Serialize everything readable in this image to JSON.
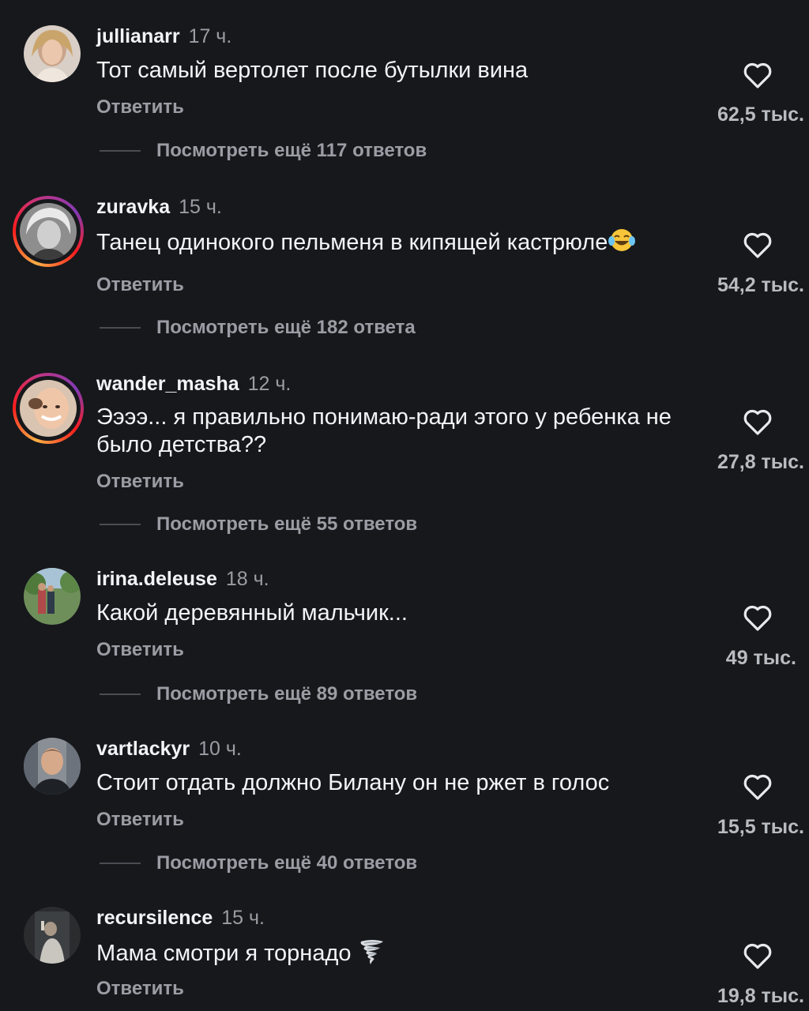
{
  "comments": [
    {
      "username": "jullianarr",
      "time": "17 ч.",
      "text": "Тот самый вертолет после бутылки вина",
      "reply_label": "Ответить",
      "likes": "62,5 тыс.",
      "more_replies": "Посмотреть ещё 117 ответов",
      "avatar_has_story": false
    },
    {
      "username": "zuravka",
      "time": "15 ч.",
      "text": "Танец одинокого пельменя в кипящей кастрюле",
      "emoji": "😂",
      "reply_label": "Ответить",
      "likes": "54,2 тыс.",
      "more_replies": "Посмотреть ещё 182 ответа",
      "avatar_has_story": true
    },
    {
      "username": "wander_masha",
      "time": "12 ч.",
      "text": "Ээээ... я правильно понимаю-ради этого у ребенка не было детства??",
      "reply_label": "Ответить",
      "likes": "27,8 тыс.",
      "more_replies": "Посмотреть ещё 55 ответов",
      "avatar_has_story": true
    },
    {
      "username": "irina.deleuse",
      "time": "18 ч.",
      "text": "Какой деревянный мальчик...",
      "reply_label": "Ответить",
      "likes": "49 тыс.",
      "more_replies": "Посмотреть ещё 89 ответов",
      "avatar_has_story": false
    },
    {
      "username": "vartlackyr",
      "time": "10 ч.",
      "text": "Стоит отдать должно Билану он не ржет в голос",
      "reply_label": "Ответить",
      "likes": "15,5 тыс.",
      "more_replies": "Посмотреть ещё 40 ответов",
      "avatar_has_story": false
    },
    {
      "username": "recursilence",
      "time": "15 ч.",
      "text": "Мама смотри я торнадо",
      "emoji": "🌪",
      "reply_label": "Ответить",
      "likes": "19,8 тыс.",
      "avatar_has_story": false
    }
  ],
  "icons": {
    "like": "heart-outline-icon",
    "laugh_emoji": "tears-of-joy-emoji",
    "tornado_emoji": "tornado-emoji"
  },
  "colors": {
    "background": "#16181c",
    "text_primary": "#f3f4f6",
    "text_secondary": "#9a9da3",
    "story_ring": "#fd1d1d"
  }
}
